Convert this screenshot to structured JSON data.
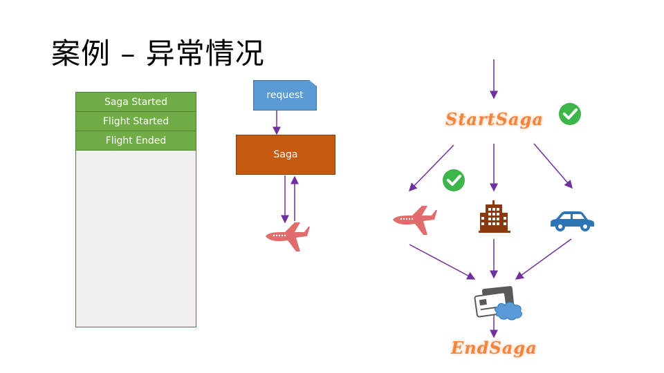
{
  "title": "案例 – 异常情况",
  "event_log": {
    "rows": [
      "Saga Started",
      "Flight Started",
      "Flight Ended"
    ]
  },
  "sequence": {
    "request_label": "request",
    "saga_label": "Saga",
    "service_icon": "airplane-icon"
  },
  "saga_flow": {
    "start_label": "StartSaga",
    "end_label": "EndSaga",
    "services": [
      {
        "name": "flight",
        "icon": "airplane-icon",
        "completed": true
      },
      {
        "name": "hotel",
        "icon": "hotel-building-icon",
        "completed": false
      },
      {
        "name": "car",
        "icon": "car-icon",
        "completed": false
      }
    ],
    "payment_icon": "payment-cards-cloud-icon",
    "start_completed": true
  },
  "colors": {
    "log_row": "#70ad47",
    "log_bg": "#f0f0f0",
    "request": "#5b9bd5",
    "saga": "#c55a11",
    "arrow": "#7030a0",
    "airplane": "#e06c6c",
    "hotel": "#8b3a0f",
    "car": "#2e75b6",
    "check": "#3cb54a",
    "script_text": "#f4843c"
  }
}
